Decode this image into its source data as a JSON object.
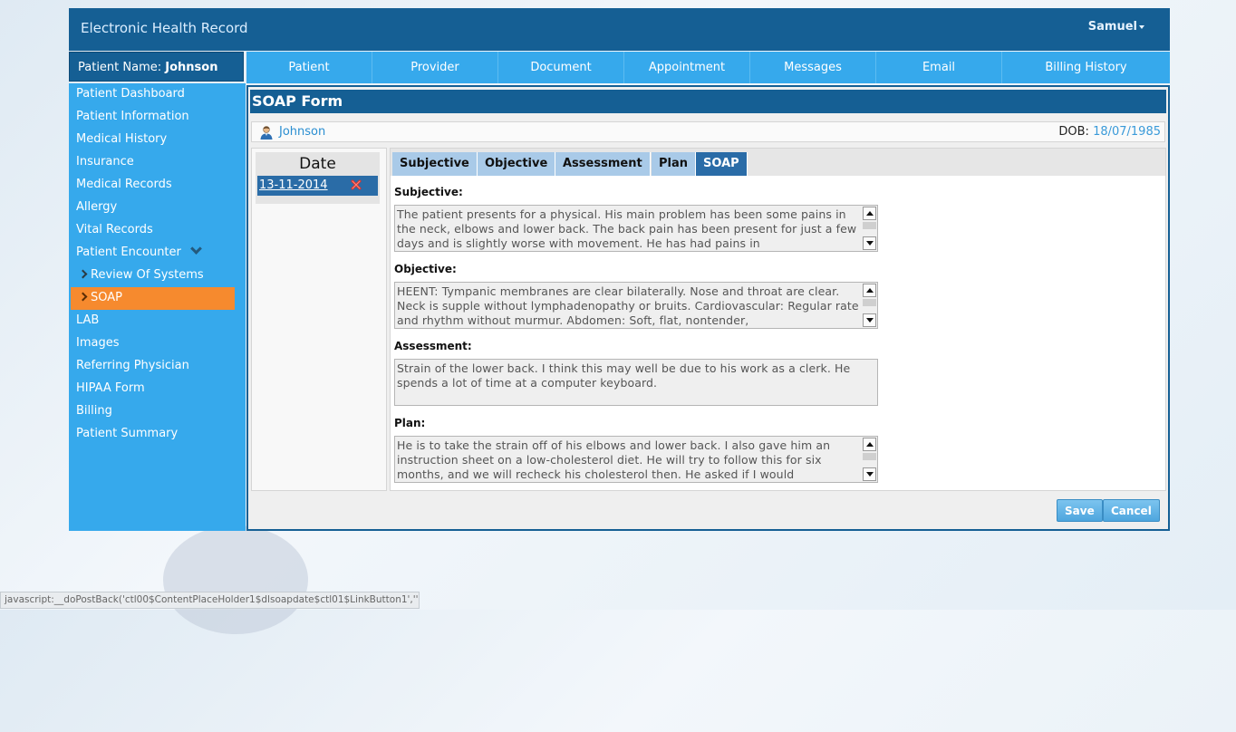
{
  "app": {
    "title": "Electronic Health Record",
    "user": "Samuel"
  },
  "patient": {
    "label": "Patient Name:",
    "name": "Johnson",
    "dob_label": "DOB:",
    "dob": "18/07/1985"
  },
  "topnav": [
    "Patient",
    "Provider",
    "Document",
    "Appointment",
    "Messages",
    "Email",
    "Billing History"
  ],
  "sidebar": {
    "items": [
      "Patient Dashboard",
      "Patient Information",
      "Medical History",
      "Insurance",
      "Medical Records",
      "Allergy",
      "Vital Records",
      "Patient Encounter",
      "Review Of Systems",
      "SOAP",
      "LAB",
      "Images",
      "Referring Physician",
      "HIPAA Form",
      "Billing",
      "Patient Summary"
    ],
    "active": "SOAP"
  },
  "form": {
    "title": "SOAP Form",
    "date_header": "Date",
    "dates": [
      "13-11-2014"
    ],
    "tabs": [
      "Subjective",
      "Objective",
      "Assessment",
      "Plan",
      "SOAP"
    ],
    "active_tab": "SOAP",
    "sections": {
      "subjective": {
        "label": "Subjective:",
        "text": "The patient presents for a physical. His main problem has been some pains in the neck, elbows and lower back. The back pain has been present for just a few days and is slightly worse with movement. He has had pains in"
      },
      "objective": {
        "label": "Objective:",
        "text": "HEENT: Tympanic membranes are clear bilaterally. Nose and throat are clear. Neck is supple without lymphadenopathy or bruits. Cardiovascular: Regular rate and rhythm without murmur. Abdomen: Soft, flat, nontender,"
      },
      "assessment": {
        "label": "Assessment:",
        "text": "Strain of the lower back. I think this may well be due to his work as a clerk. He spends a lot of time at a computer keyboard."
      },
      "plan": {
        "label": "Plan:",
        "text": "He is to take the strain off of his elbows and lower back. I also gave him an instruction sheet on a low-cholesterol diet. He will try to follow this for six months, and we will recheck his cholesterol then. He asked if I would"
      }
    },
    "save_label": "Save",
    "cancel_label": "Cancel"
  },
  "status_bar": "javascript:__doPostBack('ctl00$ContentPlaceHolder1$dlsoapdate$ctl01$LinkButton1','')",
  "colors": {
    "header": "#155f94",
    "nav": "#36a9ec",
    "active_item": "#f68a2e",
    "active_tab": "#2a6ca7"
  }
}
